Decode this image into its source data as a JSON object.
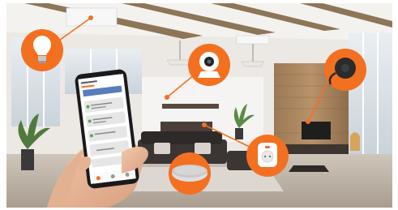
{
  "scene": {
    "subject": "smart-home-living-room",
    "accent_color": "#f37021",
    "callouts": [
      {
        "name": "smart-bulb",
        "icon": "light-bulb-icon"
      },
      {
        "name": "security-camera",
        "icon": "camera-icon"
      },
      {
        "name": "chromecast",
        "icon": "streaming-dongle-icon"
      },
      {
        "name": "smart-plug",
        "icon": "power-plug-icon"
      },
      {
        "name": "sensor-hub",
        "icon": "hub-puck-icon"
      }
    ]
  }
}
